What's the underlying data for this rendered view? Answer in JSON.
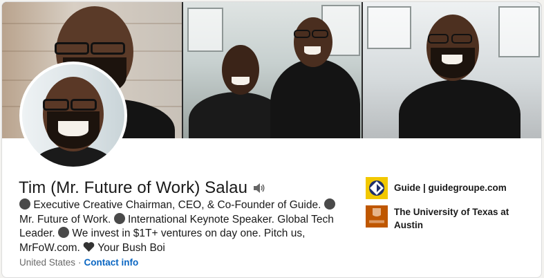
{
  "profile": {
    "name": "Tim (Mr. Future of Work) Salau",
    "headline": {
      "seg1": "Executive Creative Chairman, CEO, & Co-Founder of Guide.",
      "seg2": "Mr. Future of Work.",
      "seg3": "International Keynote Speaker. Global Tech Leader.",
      "seg4": "We invest in $1T+ ventures on day one. Pitch us, MrFoW.com.",
      "seg5": "Your Bush Boi"
    },
    "location": "United States",
    "separator": "·",
    "contact_label": "Contact info"
  },
  "orgs": [
    {
      "name": "Guide | guidegroupe.com",
      "icon": "guide-logo-icon"
    },
    {
      "name": "The University of Texas at Austin",
      "icon": "texas-logo-icon"
    }
  ],
  "colors": {
    "link": "#0a66c2",
    "page_bg": "#f3f2ef",
    "guide_yellow": "#f2c800",
    "texas_orange": "#bf5700"
  }
}
